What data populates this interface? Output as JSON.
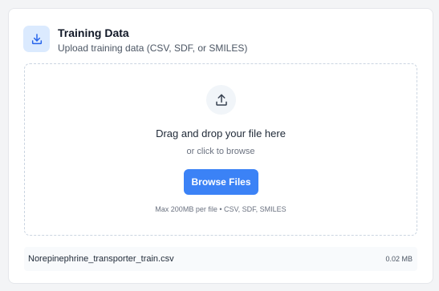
{
  "header": {
    "icon": "download-icon",
    "title": "Training Data",
    "subtitle": "Upload training data (CSV, SDF, or SMILES)"
  },
  "dropzone": {
    "icon": "upload-icon",
    "primary_text": "Drag and drop your file here",
    "secondary_text": "or click to browse",
    "button_label": "Browse Files",
    "limits_text": "Max 200MB per file • CSV, SDF, SMILES"
  },
  "file": {
    "name": "Norepinephrine_transporter_train.csv",
    "size": "0.02 MB"
  },
  "colors": {
    "accent": "#3b82f6",
    "icon_bg": "#dbeafe"
  }
}
